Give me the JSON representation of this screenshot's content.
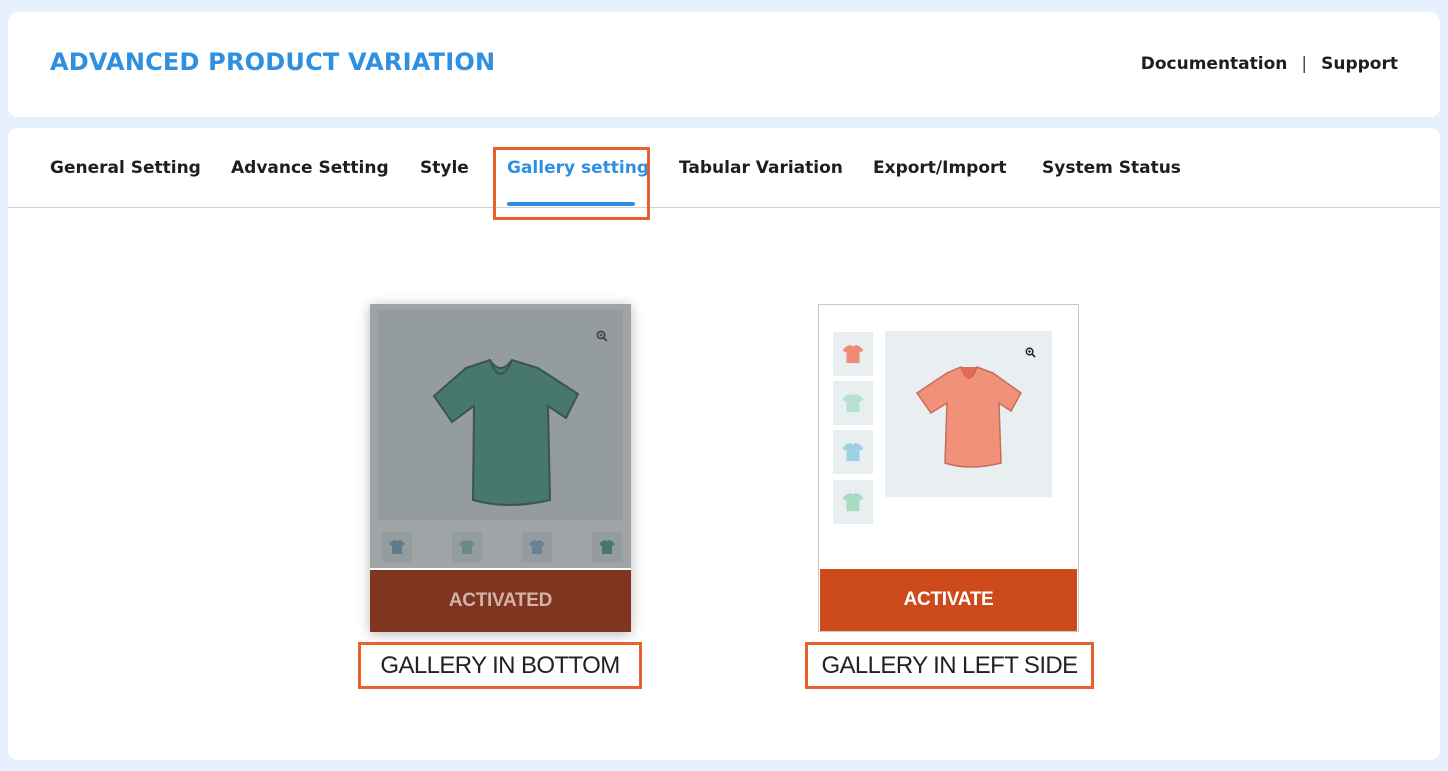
{
  "header": {
    "title": "ADVANCED PRODUCT VARIATION",
    "links": [
      "Documentation",
      "Support"
    ],
    "separator": "|"
  },
  "tabs": [
    {
      "label": "General Setting",
      "active": false
    },
    {
      "label": "Advance Setting",
      "active": false
    },
    {
      "label": "Style",
      "active": false
    },
    {
      "label": "Gallery setting",
      "active": true
    },
    {
      "label": "Tabular Variation",
      "active": false
    },
    {
      "label": "Export/Import",
      "active": false
    },
    {
      "label": "System Status",
      "active": false
    }
  ],
  "gallery_options": [
    {
      "button_label": "ACTIVATED",
      "caption": "GALLERY IN BOTTOM",
      "status": "activated"
    },
    {
      "button_label": "ACTIVATE",
      "caption": "GALLERY IN LEFT SIDE",
      "status": "inactive"
    }
  ],
  "colors": {
    "accent": "#2f8fe0",
    "highlight": "#e8602c",
    "activated_button": "#7f3520",
    "activate_button": "#cc4a1c"
  },
  "icons": [
    "zoom-in-icon",
    "t-shirt-icon"
  ]
}
